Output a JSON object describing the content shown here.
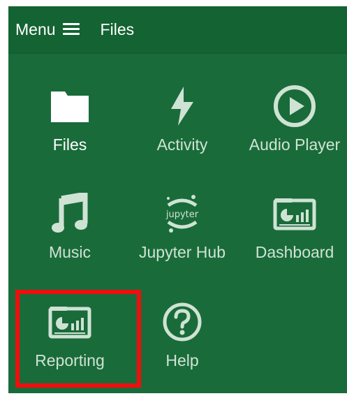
{
  "topbar": {
    "menu_label": "Menu",
    "breadcrumb": "Files"
  },
  "apps": [
    {
      "label": "Files",
      "icon": "folder-icon",
      "active": true
    },
    {
      "label": "Activity",
      "icon": "bolt-icon"
    },
    {
      "label": "Audio Player",
      "icon": "play-circle-icon"
    },
    {
      "label": "Music",
      "icon": "music-note-icon"
    },
    {
      "label": "Jupyter Hub",
      "icon": "jupyter-icon",
      "icon_text": "jupyter"
    },
    {
      "label": "Dashboard",
      "icon": "dashboard-icon"
    },
    {
      "label": "Reporting",
      "icon": "reporting-icon",
      "highlighted": true
    },
    {
      "label": "Help",
      "icon": "help-circle-icon"
    }
  ],
  "colors": {
    "background": "#1a6b3a",
    "topbar": "#146333",
    "icon": "#cfe3d4",
    "highlight": "#f20d0d"
  }
}
